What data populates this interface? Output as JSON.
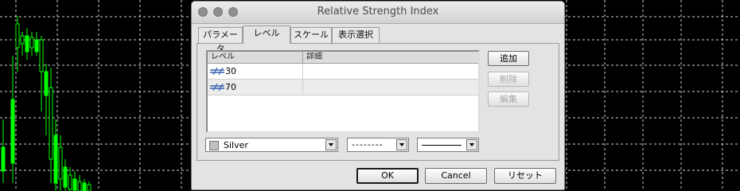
{
  "dialog": {
    "title": "Relative Strength Index"
  },
  "tabs": [
    {
      "label": "パラメータ",
      "active": false
    },
    {
      "label": "レベル",
      "active": true
    },
    {
      "label": "スケール",
      "active": false
    },
    {
      "label": "表示選択",
      "active": false
    }
  ],
  "levels": {
    "columns": [
      "レベル",
      "詳細"
    ],
    "rows": [
      {
        "value": "30",
        "description": ""
      },
      {
        "value": "70",
        "description": ""
      }
    ]
  },
  "side_buttons": {
    "add": "追加",
    "delete": "削除",
    "edit": "編集"
  },
  "style": {
    "color_name": "Silver",
    "color_hex": "#c0c0c0",
    "line_style": "--------"
  },
  "footer": {
    "ok": "OK",
    "cancel": "Cancel",
    "reset": "リセット"
  },
  "chart": {
    "background": "#000000",
    "grid_color": "#cfcfcf",
    "candle_color": "#00ff00"
  }
}
